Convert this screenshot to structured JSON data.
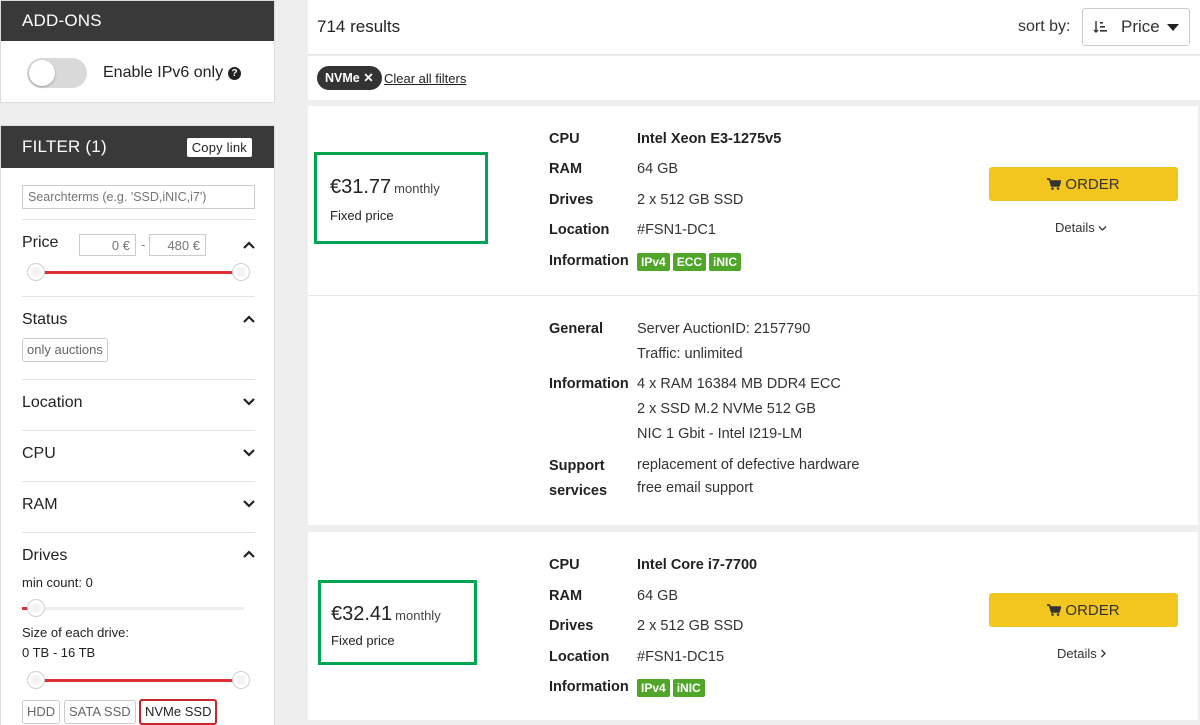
{
  "addons": {
    "title": "ADD-ONS",
    "ipv6_label": "Enable IPv6 only",
    "ipv6_enabled": false
  },
  "filter": {
    "title": "FILTER (1)",
    "copy_link": "Copy link",
    "search_placeholder": "Searchterms (e.g. 'SSD,iNIC,i7')",
    "price": {
      "title": "Price",
      "min": "0",
      "max": "480",
      "currency": "€"
    },
    "status": {
      "title": "Status",
      "tag": "only auctions"
    },
    "location": {
      "title": "Location"
    },
    "cpu": {
      "title": "CPU"
    },
    "ram": {
      "title": "RAM"
    },
    "drives": {
      "title": "Drives",
      "min_count": "min count: 0",
      "size_label": "Size of each drive:",
      "size_range": "0 TB - 16 TB",
      "types": [
        "HDD",
        "SATA SSD",
        "NVMe SSD"
      ],
      "selected_type": "NVMe SSD"
    }
  },
  "results": {
    "count": "714 results",
    "sort_label": "sort by:",
    "sort_value": "Price"
  },
  "active_filters": {
    "chip": "NVMe",
    "clear": "Clear all filters"
  },
  "servers": [
    {
      "price": "€31.77",
      "period": "monthly",
      "price_type": "Fixed price",
      "labels": {
        "cpu": "CPU",
        "ram": "RAM",
        "drives": "Drives",
        "location": "Location",
        "information": "Information"
      },
      "cpu": "Intel Xeon E3-1275v5",
      "ram": "64 GB",
      "drives": "2 x 512 GB SSD",
      "location": "#FSN1-DC1",
      "badges": [
        "IPv4",
        "ECC",
        "iNIC"
      ],
      "order": "ORDER",
      "details": "Details",
      "details_expanded": true,
      "extra": {
        "general_label": "General",
        "general": [
          "Server AuctionID: 2157790",
          "Traffic: unlimited"
        ],
        "information_label": "Information",
        "information": [
          "4 x RAM 16384 MB DDR4 ECC",
          "2 x SSD M.2 NVMe 512 GB",
          "NIC 1 Gbit - Intel I219-LM"
        ],
        "support_label_1": "Support",
        "support_label_2": "services",
        "support": [
          "replacement of defective hardware",
          "free email support"
        ]
      }
    },
    {
      "price": "€32.41",
      "period": "monthly",
      "price_type": "Fixed price",
      "labels": {
        "cpu": "CPU",
        "ram": "RAM",
        "drives": "Drives",
        "location": "Location",
        "information": "Information"
      },
      "cpu": "Intel Core i7-7700",
      "ram": "64 GB",
      "drives": "2 x 512 GB SSD",
      "location": "#FSN1-DC15",
      "badges": [
        "IPv4",
        "iNIC"
      ],
      "order": "ORDER",
      "details": "Details",
      "details_expanded": false
    }
  ],
  "colors": {
    "header_dark": "#393939",
    "order_yellow": "#f2c61f",
    "badge_green": "#4fa628",
    "highlight_green": "#00a550",
    "slider_red": "#e0303a"
  }
}
